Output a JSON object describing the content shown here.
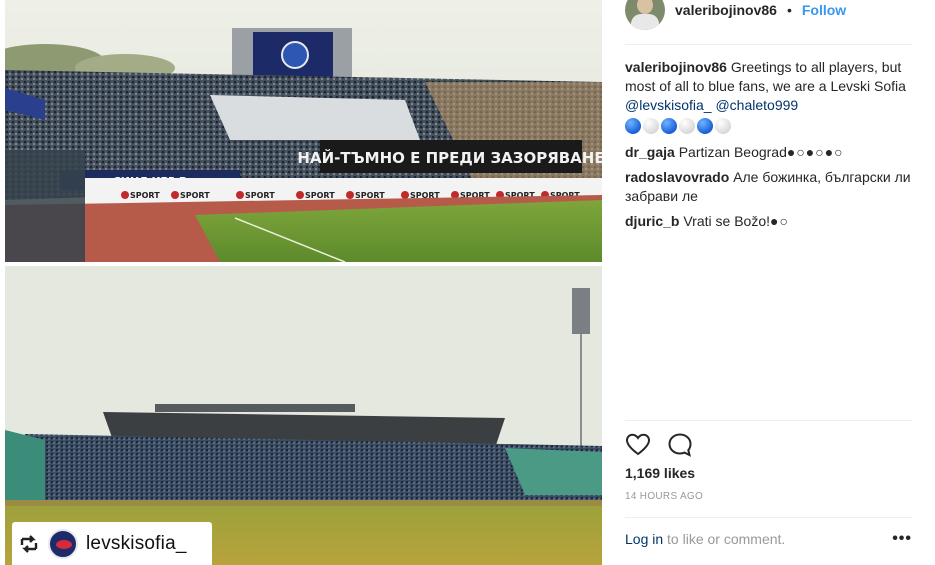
{
  "post": {
    "author": "valeribojinov86",
    "separator": "•",
    "follow_label": "Follow",
    "caption": {
      "user": "valeribojinov86",
      "text": "Greetings to all players, but most of all to blue fans, we are a Levski Sofia",
      "mention1": "@levskisofia_",
      "mention2": "@chaleto999"
    },
    "comments": [
      {
        "user": "dr_gaja",
        "text": "Partizan Beograd",
        "tail": "●○●○●○"
      },
      {
        "user": "radoslavovrado",
        "text": "Але божинка, български ли забрави ле",
        "tail": ""
      },
      {
        "user": "djuric_b",
        "text": "Vrati se Božo!",
        "tail": "●○"
      }
    ],
    "likes": "1,169 likes",
    "time_ago": "14 HOURS AGO",
    "login_label": "Log in",
    "login_rest": "to like or comment.",
    "more_label": "•••"
  },
  "photo": {
    "repost_user": "levskisofia_",
    "banner_text": "НАЙ-ТЪМНО Е ПРЕДИ ЗАЗОРЯВАНЕ",
    "sub_banner_text": "СИНЯ КРЪВ",
    "board_text": "SPORT"
  },
  "icons": {
    "like": "heart-icon",
    "comment": "speech-bubble-icon",
    "repost": "repost-icon",
    "more": "more-options-icon"
  }
}
